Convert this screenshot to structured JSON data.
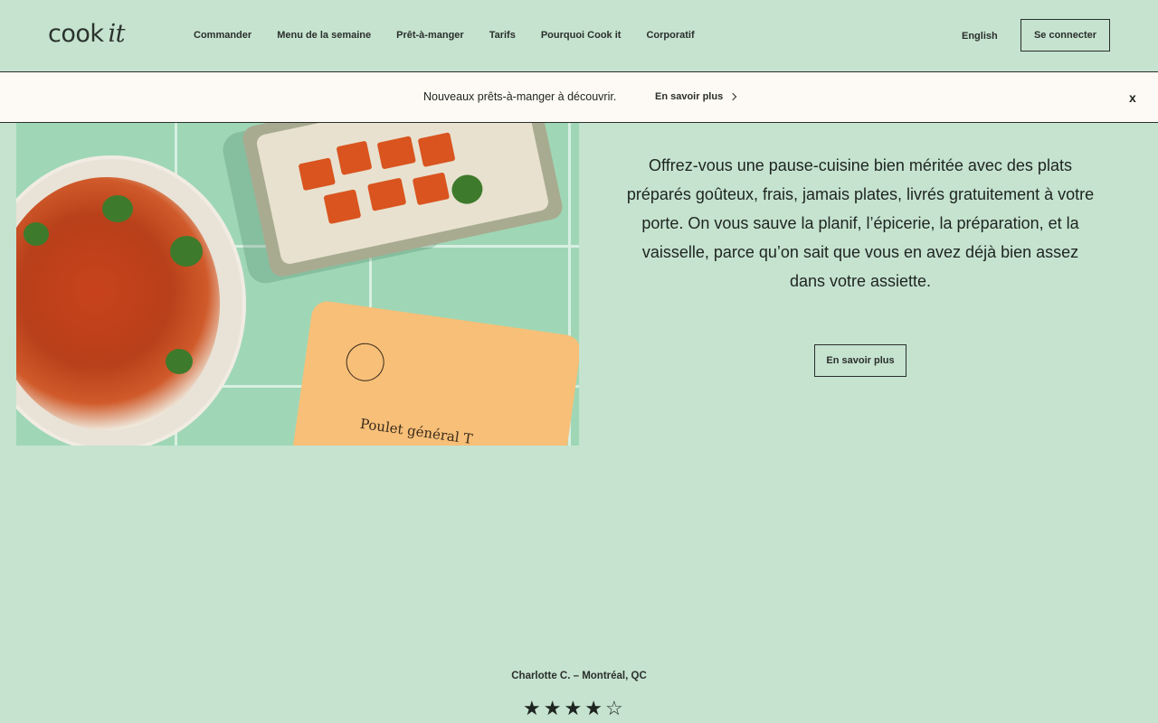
{
  "header": {
    "logo_main": "cook",
    "logo_italic": "it",
    "nav": [
      {
        "label": "Commander"
      },
      {
        "label": "Menu de la semaine"
      },
      {
        "label": "Prêt-à-manger"
      },
      {
        "label": "Tarifs"
      },
      {
        "label": "Pourquoi Cook it"
      },
      {
        "label": "Corporatif"
      }
    ],
    "language": "English",
    "login_label": "Se connecter"
  },
  "banner": {
    "text": "Nouveaux prêts-à-manger à découvrir.",
    "link_label": "En savoir plus",
    "close_label": "x"
  },
  "hero": {
    "image_box_text": "Poulet général T",
    "body": "Offrez-vous une pause-cuisine bien méritée avec des plats préparés goûteux, frais, jamais plates, livrés gratuitement à votre porte. On vous sauve la planif, l’épicerie, la préparation, et la vaisselle, parce qu’on sait que vous en avez déjà bien assez dans votre assiette.",
    "button_label": "En savoir plus"
  },
  "review": {
    "author": "Charlotte C. – Montréal, QC",
    "rating": 4,
    "max_rating": 5,
    "stars": [
      "★",
      "★",
      "★",
      "★",
      "☆"
    ]
  }
}
